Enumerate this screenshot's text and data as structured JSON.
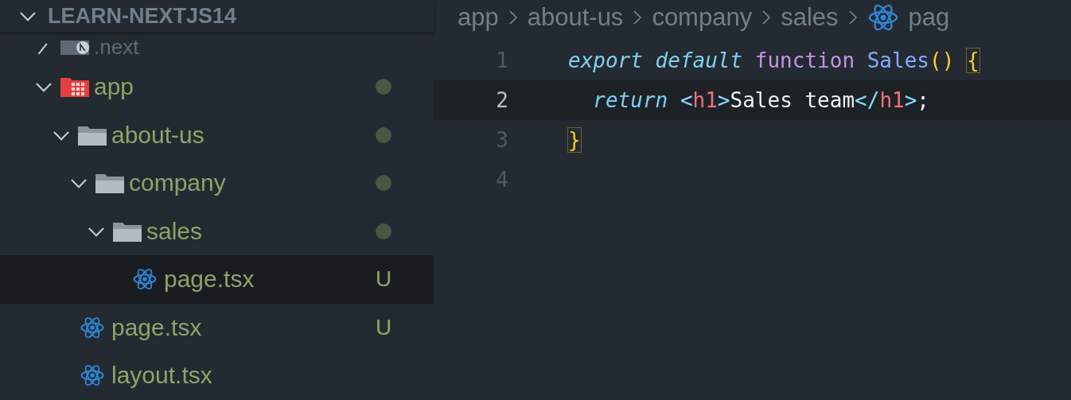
{
  "explorer": {
    "title": "LEARN-NEXTJS14",
    "expanded": true,
    "tree": [
      {
        "name": ".next",
        "kind": "next-folder",
        "expanded": false,
        "ignored": true,
        "selected": false
      },
      {
        "name": "app",
        "kind": "app-folder",
        "expanded": true,
        "ignored": false,
        "selected": false,
        "badge": {
          "kind": "dot"
        },
        "children": [
          {
            "name": "about-us",
            "kind": "folder",
            "expanded": true,
            "ignored": false,
            "selected": false,
            "badge": {
              "kind": "dot"
            },
            "children": [
              {
                "name": "company",
                "kind": "folder",
                "expanded": true,
                "ignored": false,
                "selected": false,
                "badge": {
                  "kind": "dot"
                },
                "children": [
                  {
                    "name": "sales",
                    "kind": "folder",
                    "expanded": true,
                    "ignored": false,
                    "selected": false,
                    "badge": {
                      "kind": "dot"
                    },
                    "children": [
                      {
                        "name": "page.tsx",
                        "kind": "react",
                        "ignored": false,
                        "selected": true,
                        "badge": {
                          "kind": "letter",
                          "text": "U"
                        }
                      }
                    ]
                  }
                ]
              }
            ]
          },
          {
            "name": "page.tsx",
            "kind": "react",
            "ignored": false,
            "selected": false,
            "badge": {
              "kind": "letter",
              "text": "U"
            }
          },
          {
            "name": "layout.tsx",
            "kind": "react",
            "ignored": false,
            "selected": false
          }
        ]
      }
    ]
  },
  "breadcrumbs": [
    {
      "text": "app",
      "kind": "folder"
    },
    {
      "text": "about-us",
      "kind": "folder"
    },
    {
      "text": "company",
      "kind": "folder"
    },
    {
      "text": "sales",
      "kind": "folder"
    },
    {
      "text": "pag",
      "kind": "react"
    }
  ],
  "editor": {
    "lines": [
      {
        "number": "1",
        "current": false,
        "tokens": [
          {
            "text": "export ",
            "kind": "keyword"
          },
          {
            "text": "default ",
            "kind": "keyword"
          },
          {
            "text": "function ",
            "kind": "storage"
          },
          {
            "text": "Sales",
            "kind": "func"
          },
          {
            "text": "() ",
            "kind": "paren"
          },
          {
            "text": "{",
            "kind": "bracket-match"
          }
        ]
      },
      {
        "number": "2",
        "current": true,
        "tokens": [
          {
            "text": "  return ",
            "kind": "keyword"
          },
          {
            "text": "<",
            "kind": "punct"
          },
          {
            "text": "h1",
            "kind": "tag"
          },
          {
            "text": ">",
            "kind": "punct"
          },
          {
            "text": "Sales team",
            "kind": "plain"
          },
          {
            "text": "</",
            "kind": "punct"
          },
          {
            "text": "h1",
            "kind": "tag"
          },
          {
            "text": ">",
            "kind": "punct"
          },
          {
            "text": ";",
            "kind": "plain"
          }
        ]
      },
      {
        "number": "3",
        "current": false,
        "tokens": [
          {
            "text": "}",
            "kind": "bracket-match"
          }
        ]
      },
      {
        "number": "4",
        "current": false
      }
    ]
  }
}
